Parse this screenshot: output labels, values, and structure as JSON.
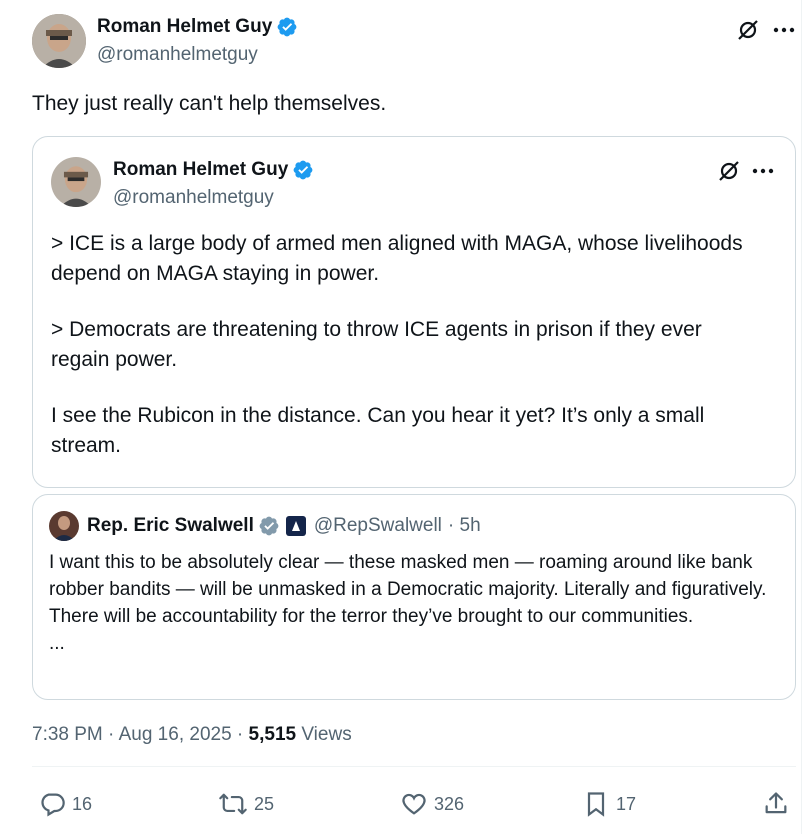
{
  "author": {
    "name": "Roman Helmet Guy",
    "handle": "@romanhelmetguy"
  },
  "tweet_text": "They just really can't help themselves.",
  "quoted": {
    "name": "Roman Helmet Guy",
    "handle": "@romanhelmetguy",
    "paragraphs": [
      "> ICE is a large body of armed men aligned with MAGA, whose livelihoods depend on MAGA staying in power.",
      "> Democrats are threatening to throw ICE agents in prison if they ever regain power.",
      "I see the Rubicon in the distance. Can you hear it yet? It’s only a small stream."
    ]
  },
  "nested_quote": {
    "name": "Rep. Eric Swalwell",
    "handle": "@RepSwalwell",
    "time": "· 5h",
    "text": "I want this to be absolutely clear — these masked men — roaming around like bank robber bandits — will be unmasked in a Democratic majority.  Literally and figuratively.  There will be accountability for the terror they’ve brought to our communities.",
    "more": "..."
  },
  "meta": {
    "timestamp": "7:38 PM · Aug 16, 2025 · ",
    "views_count": "5,515",
    "views_label": " Views"
  },
  "actions": {
    "replies": "16",
    "reposts": "25",
    "likes": "326",
    "bookmarks": "17"
  },
  "icons": {
    "verified": "verified-badge-icon",
    "grok": "grok-icon",
    "more": "more-icon",
    "reply": "reply-icon",
    "repost": "repost-icon",
    "like": "like-icon",
    "bookmark": "bookmark-icon",
    "share": "share-icon"
  },
  "colors": {
    "verified_blue": "#1d9bf0",
    "verified_gray": "#829aab",
    "text": "#0f1419",
    "secondary": "#536471",
    "border": "#cfd9de"
  }
}
